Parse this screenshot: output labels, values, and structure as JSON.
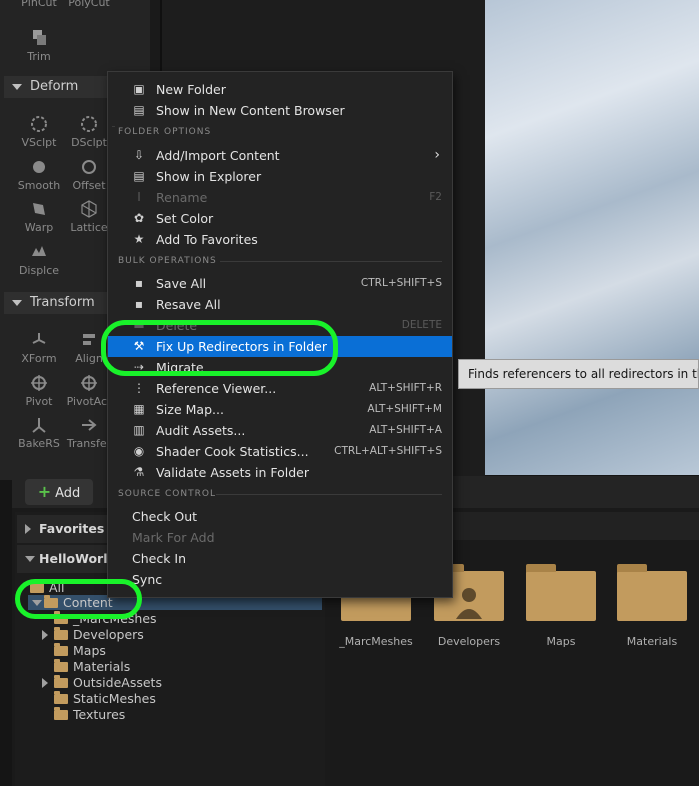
{
  "toolbar_panel": {
    "top_tools": [
      "PlnCut",
      "PolyCut",
      "Trim"
    ],
    "deform": {
      "title": "Deform",
      "tools": [
        "VSclpt",
        "DSclpt",
        "Smooth",
        "Offset",
        "Warp",
        "Lattice",
        "Displce"
      ]
    },
    "transform": {
      "title": "Transform",
      "tools": [
        "XForm",
        "Align",
        "Pivot",
        "PivotAct",
        "BakeRS",
        "Transfer"
      ]
    }
  },
  "context_menu": {
    "top": [
      {
        "label": "New Folder",
        "icon": "new-folder-icon"
      },
      {
        "label": "Show in New Content Browser",
        "icon": "content-browser-icon"
      }
    ],
    "folder_options": {
      "title": "FOLDER OPTIONS",
      "items": [
        {
          "label": "Add/Import Content",
          "icon": "import-icon",
          "submenu": "›"
        },
        {
          "label": "Show in Explorer",
          "icon": "explorer-icon"
        },
        {
          "label": "Rename",
          "icon": "rename-icon",
          "shortcut": "F2",
          "disabled": true
        },
        {
          "label": "Set Color",
          "icon": "palette-icon"
        },
        {
          "label": "Add To Favorites",
          "icon": "star-icon"
        }
      ]
    },
    "bulk_operations": {
      "title": "BULK OPERATIONS",
      "items": [
        {
          "label": "Save All",
          "icon": "save-icon",
          "shortcut": "CTRL+SHIFT+S"
        },
        {
          "label": "Resave All",
          "icon": "save-icon"
        },
        {
          "label": "Delete",
          "icon": "delete-icon",
          "shortcut": "DELETE",
          "disabled": true
        },
        {
          "label": "Fix Up Redirectors in Folder",
          "icon": "wrench-icon",
          "selected": true
        },
        {
          "label": "Migrate",
          "icon": "migrate-icon"
        },
        {
          "label": "Reference Viewer...",
          "icon": "reference-icon",
          "shortcut": "ALT+SHIFT+R"
        },
        {
          "label": "Size Map...",
          "icon": "sizemap-icon",
          "shortcut": "ALT+SHIFT+M"
        },
        {
          "label": "Audit Assets...",
          "icon": "audit-icon",
          "shortcut": "ALT+SHIFT+A"
        },
        {
          "label": "Shader Cook Statistics...",
          "icon": "shader-icon",
          "shortcut": "CTRL+ALT+SHIFT+S"
        },
        {
          "label": "Validate Assets in Folder",
          "icon": "flask-icon"
        }
      ]
    },
    "source_control": {
      "title": "SOURCE CONTROL",
      "items": [
        {
          "label": "Check Out"
        },
        {
          "label": "Mark For Add",
          "disabled": true
        },
        {
          "label": "Check In"
        },
        {
          "label": "Sync"
        }
      ]
    }
  },
  "tooltip": "Finds referencers to all redirectors in the se",
  "content_browser": {
    "add_label": "Add",
    "favorites_label": "Favorites",
    "project_label": "HelloWorld",
    "tree": [
      "All",
      "Content",
      "_MarcMeshes",
      "Developers",
      "Maps",
      "Materials",
      "OutsideAssets",
      "StaticMeshes",
      "Textures"
    ],
    "assets": [
      "_MarcMeshes",
      "Developers",
      "Maps",
      "Materials"
    ]
  },
  "colors": {
    "highlight": "#19f22a",
    "selection": "#0a6fd6",
    "folder": "#c29b5e"
  }
}
